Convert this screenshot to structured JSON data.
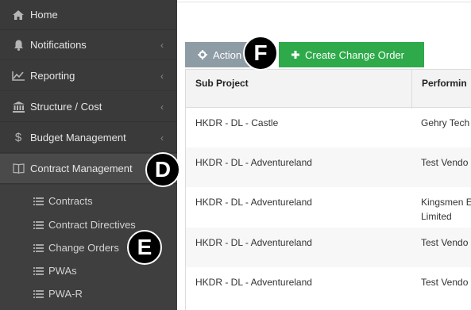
{
  "sidebar": {
    "items": [
      {
        "label": "Home",
        "icon": "home-icon"
      },
      {
        "label": "Notifications",
        "icon": "bell-icon"
      },
      {
        "label": "Reporting",
        "icon": "chart-icon"
      },
      {
        "label": "Structure / Cost",
        "icon": "building-icon"
      },
      {
        "label": "Budget Management",
        "icon": "dollar-icon"
      },
      {
        "label": "Contract Management",
        "icon": "book-icon"
      }
    ],
    "subitems": [
      {
        "label": "Contracts",
        "icon": "list-icon"
      },
      {
        "label": "Contract Directives",
        "icon": "list-icon"
      },
      {
        "label": "Change Orders",
        "icon": "list-icon"
      },
      {
        "label": "PWAs",
        "icon": "list-icon"
      },
      {
        "label": "PWA-R",
        "icon": "list-icon"
      }
    ]
  },
  "markers": {
    "d": "D",
    "e": "E",
    "f": "F"
  },
  "toolbar": {
    "action_label": "Action",
    "create_label": "Create Change Order"
  },
  "table": {
    "headers": [
      "Sub Project",
      "Performin"
    ],
    "rows": [
      [
        "HKDR - DL - Castle",
        "Gehry Tech"
      ],
      [
        "HKDR - DL - Adventureland",
        "Test Vendo"
      ],
      [
        "HKDR - DL - Adventureland",
        "Kingsmen E Limited"
      ],
      [
        "HKDR - DL - Adventureland",
        "Test Vendo"
      ],
      [
        "HKDR - DL - Adventureland",
        "Test Vendo"
      ]
    ]
  },
  "colors": {
    "sidebar_bg": "#3a3a3a",
    "action_button": "#8e9ca6",
    "create_button": "#2eaa4a"
  }
}
